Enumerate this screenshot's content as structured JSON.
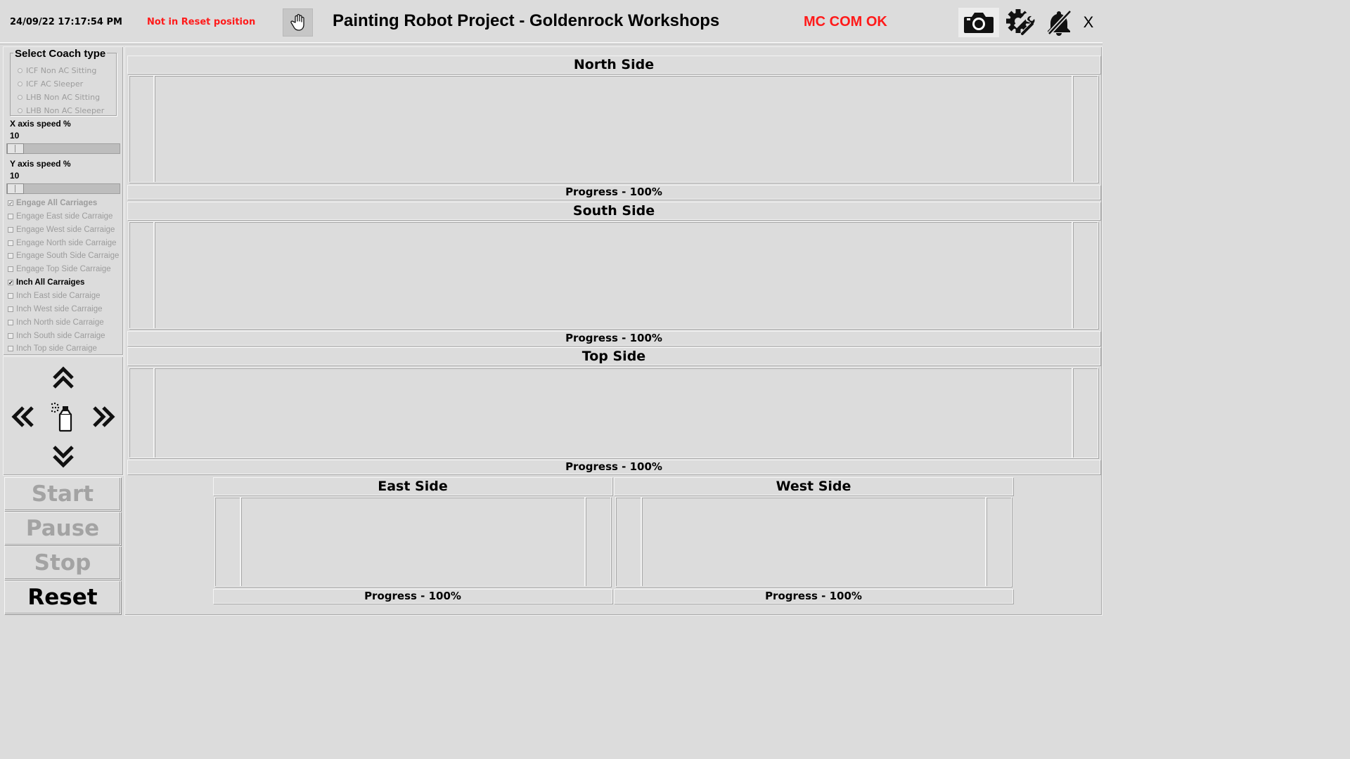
{
  "header": {
    "timestamp": "24/09/22 17:17:54 PM",
    "reset_status": "Not in Reset position",
    "title": "Painting Robot Project - Goldenrock Workshops",
    "comm_status": "MC COM OK",
    "close_label": "X",
    "status_color": "#ff1a1a"
  },
  "coach": {
    "legend": "Select Coach type",
    "options": [
      "ICF Non AC Sitting",
      "ICF AC Sleeper",
      "LHB Non AC Sitting",
      "LHB Non AC Sleeper"
    ]
  },
  "speed": {
    "x_label": "X axis speed %",
    "x_value": "10",
    "y_label": "Y axis speed %",
    "y_value": "10"
  },
  "checks": [
    {
      "label": "Engage All Carriages",
      "checked": true,
      "enabled": false
    },
    {
      "label": "Engage East side Carraige",
      "checked": false,
      "enabled": false
    },
    {
      "label": "Engage West side Carraige",
      "checked": false,
      "enabled": false
    },
    {
      "label": "Engage North side Carraige",
      "checked": false,
      "enabled": false
    },
    {
      "label": "Engage South Side Carraige",
      "checked": false,
      "enabled": false
    },
    {
      "label": "Engage Top Side Carraige",
      "checked": false,
      "enabled": false
    },
    {
      "label": "Inch All Carraiges",
      "checked": true,
      "enabled": true
    },
    {
      "label": "Inch East side Carraige",
      "checked": false,
      "enabled": false
    },
    {
      "label": "Inch West side Carraige",
      "checked": false,
      "enabled": false
    },
    {
      "label": "Inch North side Carraige",
      "checked": false,
      "enabled": false
    },
    {
      "label": "Inch South side Carraige",
      "checked": false,
      "enabled": false
    },
    {
      "label": "Inch Top side Carraige",
      "checked": false,
      "enabled": false
    }
  ],
  "actions": {
    "start": "Start",
    "pause": "Pause",
    "stop": "Stop",
    "reset": "Reset"
  },
  "sections": {
    "north": {
      "title": "North Side",
      "progress": "Progress - 100%",
      "progress_value": 100
    },
    "south": {
      "title": "South Side",
      "progress": "Progress - 100%",
      "progress_value": 100
    },
    "top": {
      "title": "Top Side",
      "progress": "Progress - 100%",
      "progress_value": 100
    },
    "east": {
      "title": "East Side",
      "progress": "Progress - 100%",
      "progress_value": 100
    },
    "west": {
      "title": "West Side",
      "progress": "Progress - 100%",
      "progress_value": 100
    }
  },
  "icons": {
    "hand": "hand-icon",
    "camera": "camera-icon",
    "settings": "gear-wrench-icon",
    "alarm": "bell-muted-icon",
    "up": "double-chevron-up-icon",
    "down": "double-chevron-down-icon",
    "left": "double-chevron-left-icon",
    "right": "double-chevron-right-icon",
    "spray": "spray-can-icon"
  }
}
